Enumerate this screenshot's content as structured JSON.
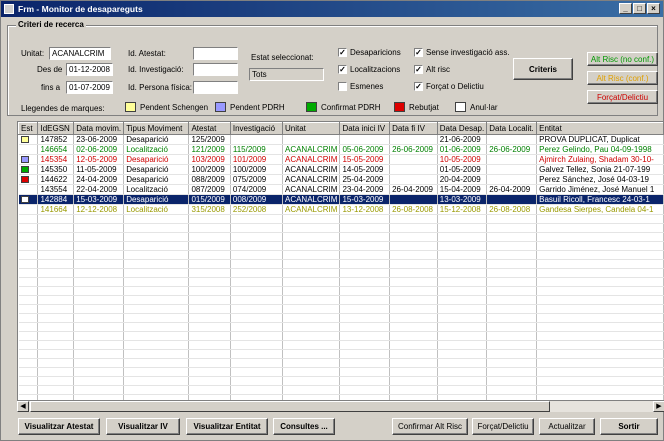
{
  "window": {
    "title": "Frm - Monitor de desapareguts",
    "controls": [
      "_",
      "□",
      "×"
    ]
  },
  "search": {
    "group_title": "Criteri de recerca",
    "unitat_label": "Unitat:",
    "unitat_value": "ACANALCRIM",
    "des_de_label": "Des de",
    "des_de_value": "01-12-2008",
    "fins_a_label": "fins a",
    "fins_a_value": "01-07-2009",
    "id_atestat_label": "Id. Atestat:",
    "id_investigacio_label": "Id. Investigació:",
    "id_persona_label": "Id. Persona física:",
    "estat_label": "Estat seleccionat:",
    "estat_value": "Tots",
    "checks": {
      "desaparicions": "Desaparicions",
      "localitzacions": "Localitzacions",
      "esmenes": "Esmenes",
      "sense_investigacio": "Sense investigació ass.",
      "alt_risc": "Alt risc",
      "forcat_delictiu": "Forçat o Delictiu"
    },
    "criteris_button": "Criteris",
    "right_buttons": {
      "alt_risc_no_conf": "Alt Risc (no conf.)",
      "alt_risc_conf": "Alt Risc (conf.)",
      "forcat_delictiu": "Forçat/Delictiu"
    }
  },
  "legend": {
    "label": "Llegendes de marques:",
    "items": [
      {
        "label": "Pendent Schengen",
        "color": "#ffff99"
      },
      {
        "label": "Pendent PDRH",
        "color": "#9999ff"
      },
      {
        "label": "Confirmat PDRH",
        "color": "#00aa00"
      },
      {
        "label": "Rebutjat",
        "color": "#dd0000"
      },
      {
        "label": "Anul·lar",
        "color": "#ffffff"
      }
    ]
  },
  "table": {
    "columns": [
      "Est",
      "IdEGSN",
      "Data movim.",
      "Tipus Moviment",
      "Atestat",
      "Investigació",
      "Unitat",
      "Data inici IV",
      "Data fi IV",
      "Data Desap.",
      "Data Localit.",
      "Entitat"
    ],
    "rows": [
      {
        "mark": "#ffff99",
        "color": "#000000",
        "selected": false,
        "cells": [
          "147852",
          "23-06-2009",
          "Desaparició",
          "125/2009",
          "",
          "",
          "",
          "",
          "21-06-2009",
          "",
          "PROVA DUPLICAT, Duplicat"
        ]
      },
      {
        "mark": "",
        "color": "#008000",
        "selected": false,
        "cells": [
          "146654",
          "02-06-2009",
          "Localització",
          "121/2009",
          "115/2009",
          "ACANALCRIM",
          "05-06-2009",
          "26-06-2009",
          "01-06-2009",
          "26-06-2009",
          "Perez Gelindo, Pau 04-09-1998"
        ]
      },
      {
        "mark": "#9999ff",
        "color": "#cc0000",
        "selected": false,
        "cells": [
          "145354",
          "12-05-2009",
          "Desaparició",
          "103/2009",
          "101/2009",
          "ACANALCRIM",
          "15-05-2009",
          "",
          "10-05-2009",
          "",
          "Ajmirch Zulaing, Shadam 30-10-"
        ]
      },
      {
        "mark": "#00aa00",
        "color": "#000000",
        "selected": false,
        "cells": [
          "145350",
          "11-05-2009",
          "Desaparició",
          "100/2009",
          "100/2009",
          "ACANALCRIM",
          "14-05-2009",
          "",
          "01-05-2009",
          "",
          "Galvez Tellez, Sonia 21-07-199"
        ]
      },
      {
        "mark": "#dd0000",
        "color": "#000000",
        "selected": false,
        "cells": [
          "144622",
          "24-04-2009",
          "Desaparició",
          "088/2009",
          "075/2009",
          "ACANALCRIM",
          "25-04-2009",
          "",
          "20-04-2009",
          "",
          "Perez Sánchez, José 04-03-19"
        ]
      },
      {
        "mark": "",
        "color": "#000000",
        "selected": false,
        "cells": [
          "143554",
          "22-04-2009",
          "Localització",
          "087/2009",
          "074/2009",
          "ACANALCRIM",
          "23-04-2009",
          "26-04-2009",
          "15-04-2009",
          "26-04-2009",
          "Garrido Jiménez, José Manuel 1"
        ]
      },
      {
        "mark": "#ffffff",
        "color": "#ffffff",
        "selected": true,
        "cells": [
          "142884",
          "15-03-2009",
          "Desaparició",
          "015/2009",
          "008/2009",
          "ACANALCRIM",
          "15-03-2009",
          "",
          "13-03-2009",
          "",
          "Basuil Ricoll, Francesc 24-03-1"
        ]
      },
      {
        "mark": "",
        "color": "#999900",
        "selected": false,
        "cells": [
          "141664",
          "12-12-2008",
          "Localització",
          "315/2008",
          "252/2008",
          "ACANALCRIM",
          "13-12-2008",
          "26-08-2008",
          "15-12-2008",
          "26-08-2008",
          "Gandesa Sierpes, Candela 04-1"
        ]
      }
    ]
  },
  "footer": {
    "visualitzar_atestat": "Visualitzar Atestat",
    "visualitzar_iv": "Visualitzar IV",
    "visualitzar_entitat": "Visualitzar Entitat",
    "consultes": "Consultes ...",
    "confirmar_alt_risc": "Confirmar Alt Risc",
    "forcat_delictiu": "Forçat/Delictiu",
    "actualitzar": "Actualitzar",
    "sortir": "Sortir"
  }
}
